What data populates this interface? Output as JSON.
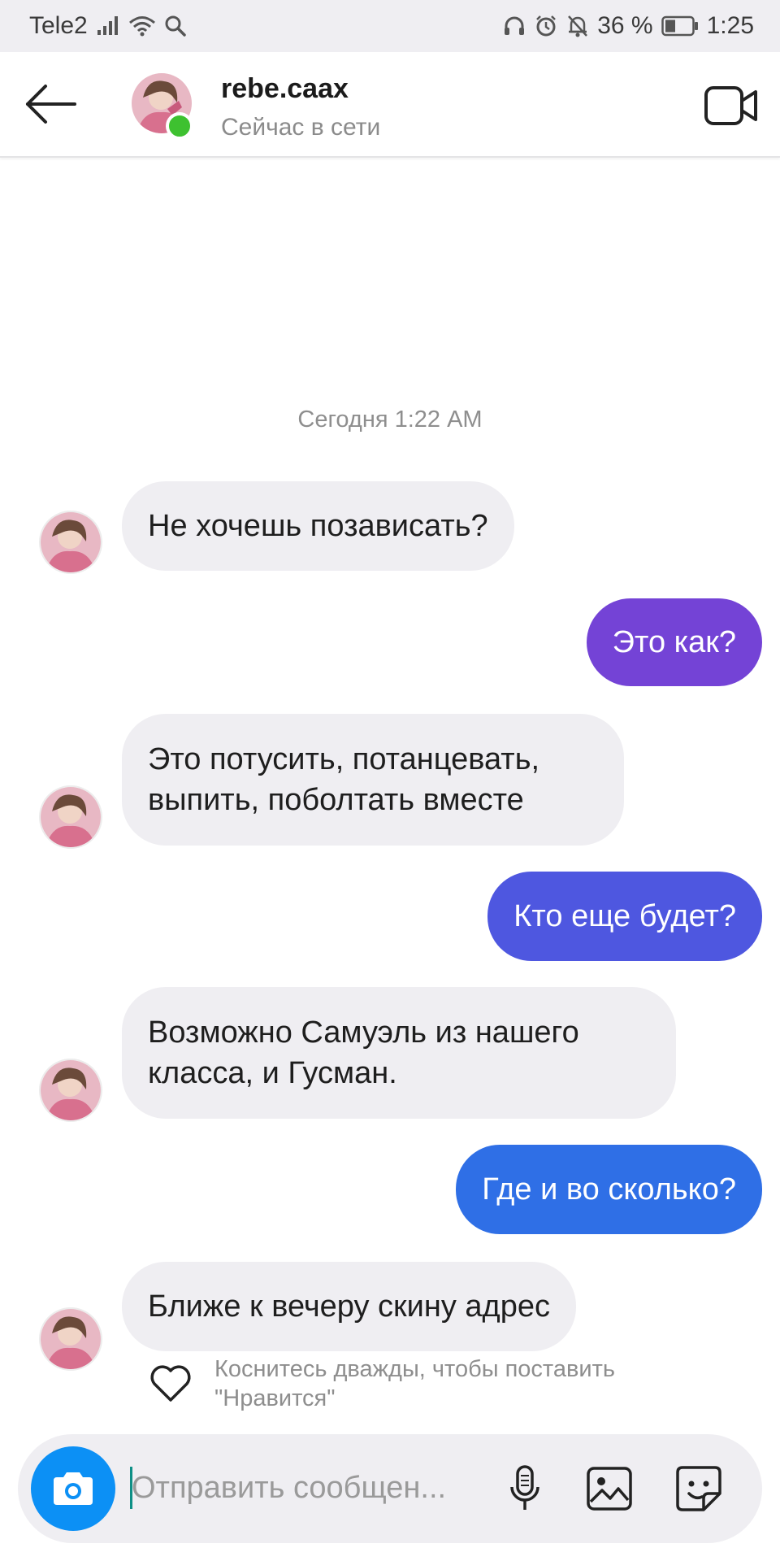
{
  "status_bar": {
    "carrier": "Tele2",
    "battery_percent": "36 %",
    "time": "1:25"
  },
  "header": {
    "username": "rebe.caax",
    "presence": "Сейчас в сети",
    "online": true
  },
  "chat": {
    "timestamp": "Сегодня 1:22 AM",
    "messages": [
      {
        "from": "them",
        "text": "Не хочешь позависать?"
      },
      {
        "from": "me",
        "text": "Это как?"
      },
      {
        "from": "them",
        "text": "Это потусить, потанцевать, выпить, поболтать вместе"
      },
      {
        "from": "me",
        "text": "Кто еще будет?"
      },
      {
        "from": "them",
        "text": "Возможно Самуэль из нашего класса, и Гусман."
      },
      {
        "from": "me",
        "text": "Где и во сколько?"
      },
      {
        "from": "them",
        "text": "Ближе к вечеру скину адрес"
      }
    ],
    "like_hint": "Коснитесь дважды, чтобы поставить \"Нравится\""
  },
  "composer": {
    "placeholder": "Отправить сообщен..."
  },
  "icons": {
    "back": "back-arrow-icon",
    "video_call": "video-camera-icon",
    "camera": "camera-icon",
    "mic": "microphone-icon",
    "gallery": "gallery-icon",
    "sticker": "sticker-icon",
    "like": "heart-icon"
  },
  "colors": {
    "incoming_bubble": "#efeef2",
    "outgoing_bubbles": [
      "#7443d6",
      "#4e57e0",
      "#2f6fe6"
    ],
    "camera_button": "#0c90f5",
    "online": "#3ec130"
  }
}
